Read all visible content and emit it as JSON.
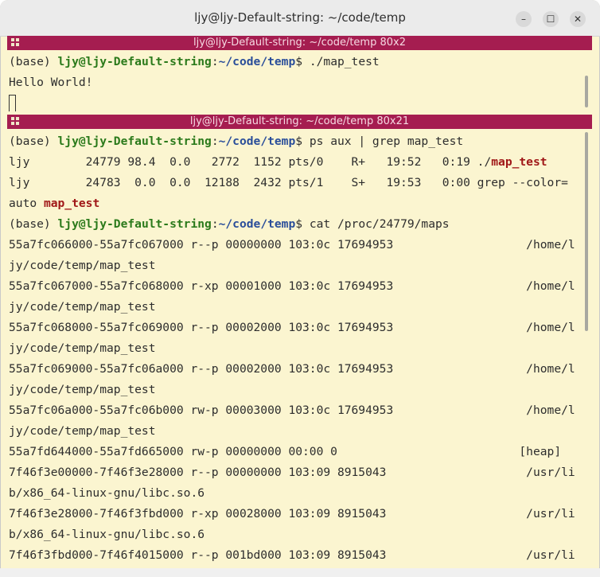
{
  "window": {
    "title": "ljy@ljy-Default-string: ~/code/temp",
    "minimize_label": "–",
    "maximize_label": "☐",
    "close_label": "✕"
  },
  "pane1": {
    "header": "ljy@ljy-Default-string: ~/code/temp 80x2",
    "prompt": {
      "env": "(base) ",
      "userhost": "ljy@ljy-Default-string",
      "colon": ":",
      "path": "~/code/temp",
      "dollar": "$ ",
      "command": "./map_test"
    },
    "output": "Hello World!"
  },
  "pane2": {
    "header": "ljy@ljy-Default-string: ~/code/temp 80x21",
    "prompt1": {
      "env": "(base) ",
      "userhost": "ljy@ljy-Default-string",
      "colon": ":",
      "path": "~/code/temp",
      "dollar": "$ ",
      "command": "ps aux | grep map_test"
    },
    "ps_row1": {
      "text": "ljy        24779 98.4  0.0   2772  1152 pts/0    R+   19:52   0:19 ./",
      "match": "map_test"
    },
    "ps_row2": {
      "text": "ljy        24783  0.0  0.0  12188  2432 pts/1    S+   19:53   0:00 grep --color="
    },
    "ps_row3": {
      "text": "auto ",
      "match": "map_test"
    },
    "prompt2": {
      "env": "(base) ",
      "userhost": "ljy@ljy-Default-string",
      "colon": ":",
      "path": "~/code/temp",
      "dollar": "$ ",
      "command": "cat /proc/24779/maps"
    },
    "maps_lines": [
      "55a7fc066000-55a7fc067000 r--p 00000000 103:0c 17694953                   /home/l",
      "jy/code/temp/map_test",
      "55a7fc067000-55a7fc068000 r-xp 00001000 103:0c 17694953                   /home/l",
      "jy/code/temp/map_test",
      "55a7fc068000-55a7fc069000 r--p 00002000 103:0c 17694953                   /home/l",
      "jy/code/temp/map_test",
      "55a7fc069000-55a7fc06a000 r--p 00002000 103:0c 17694953                   /home/l",
      "jy/code/temp/map_test",
      "55a7fc06a000-55a7fc06b000 rw-p 00003000 103:0c 17694953                   /home/l",
      "jy/code/temp/map_test",
      "55a7fd644000-55a7fd665000 rw-p 00000000 00:00 0                          [heap]",
      "7f46f3e00000-7f46f3e28000 r--p 00000000 103:09 8915043                    /usr/li",
      "b/x86_64-linux-gnu/libc.so.6",
      "7f46f3e28000-7f46f3fbd000 r-xp 00028000 103:09 8915043                    /usr/li",
      "b/x86_64-linux-gnu/libc.so.6",
      "7f46f3fbd000-7f46f4015000 r--p 001bd000 103:09 8915043                    /usr/li"
    ]
  }
}
